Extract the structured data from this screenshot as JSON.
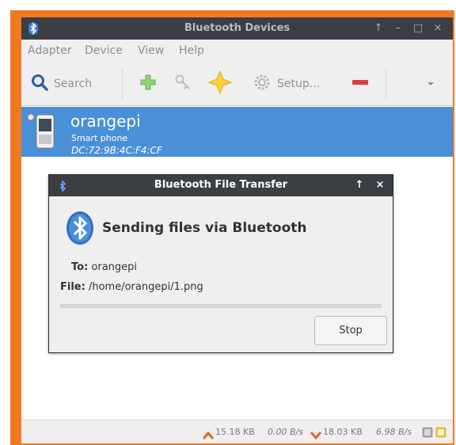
{
  "window": {
    "title": "Bluetooth Devices",
    "controls": [
      "↑",
      "–",
      "□",
      "×"
    ]
  },
  "menubar": {
    "items": [
      "Adapter",
      "Device",
      "View",
      "Help"
    ]
  },
  "toolbar": {
    "search_label": "Search",
    "setup_label": "Setup...",
    "overflow_icon": "chevron-down-icon"
  },
  "device": {
    "name": "orangepi",
    "type": "Smart phone",
    "address": "DC:72:9B:4C:F4:CF"
  },
  "dialog": {
    "title": "Bluetooth File Transfer",
    "controls": [
      "↑",
      "×"
    ],
    "heading": "Sending files via Bluetooth",
    "to_label": "To:",
    "to_value": "orangepi",
    "file_label": "File:",
    "file_value": "/home/orangepi/1.png",
    "progress": 0,
    "stop_label": "Stop"
  },
  "statusbar": {
    "upload_total": "15.18 KB",
    "upload_rate": "0.00 B/s",
    "download_total": "18.03 KB",
    "download_rate": "6.98 B/s"
  },
  "colors": {
    "accent": "#4a90d9",
    "frame": "#ef7a22",
    "titlebar": "#3b3e42",
    "remove": "#e03a3e"
  }
}
